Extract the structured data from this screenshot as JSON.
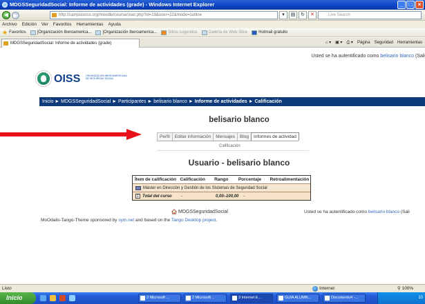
{
  "window": {
    "title": "MDGSSeguridadSocial: Informe de actividades (grade) - Windows Internet Explorer",
    "controls": [
      "_",
      "□",
      "×"
    ]
  },
  "browser": {
    "address": "http://campusoiss.org/moodle/course/user.php?id=19&user=22&mode=outline",
    "search_placeholder": "Live Search",
    "menu": [
      "Archivo",
      "Edición",
      "Ver",
      "Favoritos",
      "Herramientas",
      "Ayuda"
    ],
    "favorites_label": "Favoritos",
    "favorites": [
      {
        "label": "[Organización Iberoamerica...",
        "icon": "page-icon"
      },
      {
        "label": "[Organización Iberoamerica...",
        "icon": "page-icon"
      },
      {
        "label": "Sitios sugeridos",
        "icon": "orange-tile-icon",
        "dim": true
      },
      {
        "label": "Galería de Web Slice",
        "icon": "web-slice-icon",
        "dim": true
      },
      {
        "label": "Hotmail gratuito",
        "icon": "hotmail-icon"
      }
    ],
    "tab_title": "MDGSSeguridadSocial: Informe de actividades (grade)",
    "tab_tools": [
      "Página",
      "Seguridad",
      "Herramientas"
    ],
    "status_text": "Listo",
    "zone": "Internet",
    "zoom": "100%"
  },
  "page": {
    "login_text": "Usted se ha autentificado como",
    "login_user": "belisario blanco",
    "login_suffix": "(Sali",
    "logo_word": "OISS",
    "logo_sub": "ORGANIZACIÓN IBEROAMERICANA DE SEGURIDAD SOCIAL",
    "breadcrumb": [
      "Inicio",
      "MDGSSeguridadSocial",
      "Participantes",
      "belisario blanco",
      "Informe de actividades",
      "Calificación"
    ],
    "user_heading": "belisario blanco",
    "profile_tabs": [
      {
        "label": "Perfil",
        "active": false
      },
      {
        "label": "Editar información",
        "active": false
      },
      {
        "label": "Mensajes",
        "active": false
      },
      {
        "label": "Blog",
        "active": false
      },
      {
        "label": "Informes de actividad",
        "active": true
      }
    ],
    "subtab": "Calificación",
    "report_heading": "Usuario - belisario blanco",
    "grade_table": {
      "headers": [
        "Ítem de calificación",
        "Calificación",
        "Rango",
        "Porcentaje",
        "Retroalimentación"
      ],
      "course_row": "Máster en Dirección y Gestión de los Sistemas de Seguridad Social",
      "total_row": {
        "label": "Total del curso",
        "grade": "-",
        "range": "0,00–100,00",
        "percent": "-"
      }
    },
    "footer_site": "MDGSSeguridadSocial",
    "footer_login_text": "Usted se ha autentificado como",
    "footer_login_user": "belisario blanco",
    "footer_login_suffix": "(Sali",
    "credits_prefix": "MoOdalis-Tango-Theme sponsored by",
    "credits_link": "sym.net",
    "credits_mid": "and based on the",
    "credits_link2": "Tango Desktop project",
    "credits_end": "."
  },
  "taskbar": {
    "start_label": "Inicio",
    "tasks": [
      "2 Microsoft ...",
      "2 Microsoft ...",
      "3 Internet E...",
      "GUIA ALUMN...",
      "Documento4 -..."
    ],
    "clock": "10"
  },
  "colors": {
    "navbar": "#0d3a78",
    "link": "#3366bb",
    "arrow": "#e8101a",
    "grade_row": "#f5e6d2"
  }
}
